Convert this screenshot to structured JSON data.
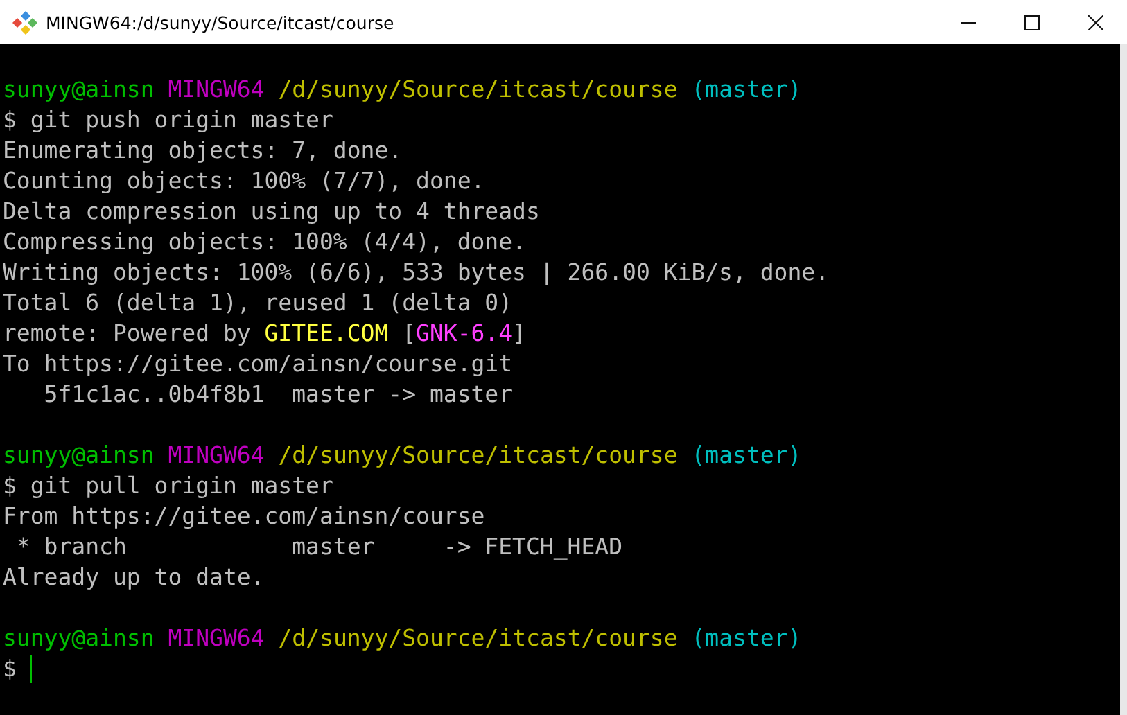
{
  "window": {
    "title": "MINGW64:/d/sunyy/Source/itcast/course"
  },
  "sessions": [
    {
      "prompt": [
        {
          "text": "sunyy@ainsn",
          "color": "#00bf00"
        },
        {
          "text": "MINGW64",
          "color": "#bf00bf"
        },
        {
          "text": "/d/sunyy/Source/itcast/course",
          "color": "#bfbf00"
        },
        {
          "text": "(master)",
          "color": "#00bfbf"
        }
      ],
      "sign": "$",
      "command": "git push origin master",
      "cursor": false,
      "output": [
        {
          "segments": [
            {
              "text": "Enumerating objects: 7, done."
            }
          ]
        },
        {
          "segments": [
            {
              "text": "Counting objects: 100% (7/7), done."
            }
          ]
        },
        {
          "segments": [
            {
              "text": "Delta compression using up to 4 threads"
            }
          ]
        },
        {
          "segments": [
            {
              "text": "Compressing objects: 100% (4/4), done."
            }
          ]
        },
        {
          "segments": [
            {
              "text": "Writing objects: 100% (6/6), 533 bytes | 266.00 KiB/s, done."
            }
          ]
        },
        {
          "segments": [
            {
              "text": "Total 6 (delta 1), reused 1 (delta 0)"
            }
          ]
        },
        {
          "segments": [
            {
              "text": "remote: Powered by "
            },
            {
              "text": "GITEE.COM",
              "color": "#ffff40"
            },
            {
              "text": " ["
            },
            {
              "text": "GNK-6.4",
              "color": "#ff40ff"
            },
            {
              "text": "]"
            }
          ]
        },
        {
          "segments": [
            {
              "text": "To https://gitee.com/ainsn/course.git"
            }
          ]
        },
        {
          "segments": [
            {
              "text": "   5f1c1ac..0b4f8b1  master -> master"
            }
          ]
        }
      ]
    },
    {
      "prompt": [
        {
          "text": "sunyy@ainsn",
          "color": "#00bf00"
        },
        {
          "text": "MINGW64",
          "color": "#bf00bf"
        },
        {
          "text": "/d/sunyy/Source/itcast/course",
          "color": "#bfbf00"
        },
        {
          "text": "(master)",
          "color": "#00bfbf"
        }
      ],
      "sign": "$",
      "command": "git pull origin master",
      "cursor": false,
      "output": [
        {
          "segments": [
            {
              "text": "From https://gitee.com/ainsn/course"
            }
          ]
        },
        {
          "segments": [
            {
              "text": " * branch            master     -> FETCH_HEAD"
            }
          ]
        },
        {
          "segments": [
            {
              "text": "Already up to date."
            }
          ]
        }
      ]
    },
    {
      "prompt": [
        {
          "text": "sunyy@ainsn",
          "color": "#00bf00"
        },
        {
          "text": "MINGW64",
          "color": "#bf00bf"
        },
        {
          "text": "/d/sunyy/Source/itcast/course",
          "color": "#bfbf00"
        },
        {
          "text": "(master)",
          "color": "#00bfbf"
        }
      ],
      "sign": "$",
      "cursor": true
    }
  ]
}
